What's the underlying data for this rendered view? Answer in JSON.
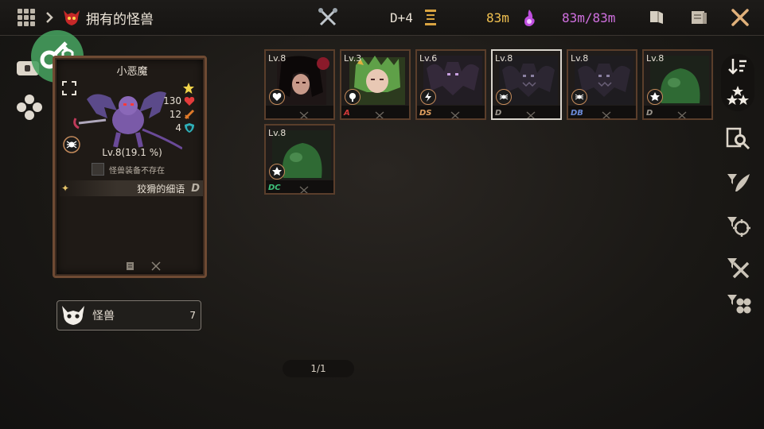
{
  "header": {
    "title": "拥有的怪兽",
    "day": "D+4",
    "resource_1": "83m",
    "resource_2": "83m/83m"
  },
  "card": {
    "name": "小恶魔",
    "stats": {
      "hp": "130",
      "attack": "12",
      "defense": "4"
    },
    "level": "Lv.8(19.1 %)",
    "equipment": "怪兽装备不存在",
    "skill": "狡猾的细语",
    "skill_grade": "D"
  },
  "monster_button": {
    "label": "怪兽",
    "count": "7"
  },
  "monsters": [
    {
      "level": "Lv.8",
      "type": "heart",
      "grade": "",
      "grade_color": "#c83a3a",
      "art": "dark-girl",
      "selected": false
    },
    {
      "level": "Lv.3",
      "type": "tree",
      "grade": "A",
      "grade_color": "#d23a3a",
      "art": "green-girl",
      "selected": false
    },
    {
      "level": "Lv.6",
      "type": "bolt",
      "grade": "DS",
      "grade_color": "#e0a060",
      "art": "bat",
      "selected": false
    },
    {
      "level": "Lv.8",
      "type": "spider",
      "grade": "D",
      "grade_color": "#9a948c",
      "art": "dark-bat",
      "selected": true
    },
    {
      "level": "Lv.8",
      "type": "spider",
      "grade": "DB",
      "grade_color": "#6a8ad8",
      "art": "dark-bat",
      "selected": false
    },
    {
      "level": "Lv.8",
      "type": "star",
      "grade": "D",
      "grade_color": "#9a948c",
      "art": "slime",
      "selected": false
    },
    {
      "level": "Lv.8",
      "type": "star",
      "grade": "DC",
      "grade_color": "#3ec07a",
      "art": "slime",
      "selected": false
    }
  ],
  "pager": "1/1",
  "colors": {
    "accent_gold": "#f0c050",
    "accent_purple": "#d070e0",
    "frame": "#6e4a33"
  }
}
